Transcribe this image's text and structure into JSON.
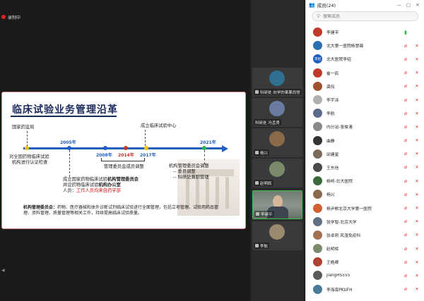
{
  "recording": {
    "label": "录制中"
  },
  "slide": {
    "title": "临床试验业务管理沿革",
    "years": [
      "2005年",
      "2008年",
      "2014年",
      "2017年",
      "2021年"
    ],
    "left_top": "国家药监局",
    "left_desc1": "对全国药物临床试验",
    "left_desc2": "机构进行认证检查",
    "center_top": "成立临床试验中心",
    "mid_label": "管理委员会成员调整",
    "est1": "成立国家药物临床试验",
    "est1_bold": "机构管理委员会",
    "est2": "并设药物临床试验",
    "est2_bold": "机构办公室",
    "est3_prefix": "人员：",
    "est3_red": "工作人员均来自药学部",
    "adj1": "机构管理委员会调整",
    "adj2": "-- 委员调整",
    "adj3": "-- 科研处兼职管理",
    "bottom_bold": "机构管理委员会：",
    "bottom_text": "药物、医疗器械和体外诊断试剂临床试验进行全面管理，包括立项管理、试验用药品管理、资料管理、质量管理等相关工作，持续提高临床试验质量。",
    "colors": {
      "timeline": "#1f5fbf",
      "title": "#1a2a5a",
      "highlight_red": "#d01010"
    }
  },
  "video_tiles": [
    {
      "name": "科研处 向学的果果尚常",
      "avatar_color": "#2f6f8f"
    },
    {
      "name": "科研处 冯孟贤",
      "avatar_color": "#6a7aa0"
    },
    {
      "name": "杨兴",
      "avatar_color": "#8a6a4a"
    },
    {
      "name": "赵明辉",
      "avatar_color": "#7a8a6a"
    },
    {
      "name": "李建平",
      "avatar_color": "#000000",
      "camera": true
    },
    {
      "name": "于 ",
      "avatar_color": "#9a8a70"
    },
    {
      "name": "李航",
      "avatar_color": "#5a6a8a"
    }
  ],
  "panel": {
    "title": "成员(24)",
    "search_placeholder": "搜索成员",
    "members": [
      {
        "name": "李建平",
        "avatar_color": "#c0392b",
        "mic_on": true,
        "cam_icon": ""
      },
      {
        "name": "北大第一医院杨慧薇",
        "avatar_color": "#2a6fb0",
        "mic_on": false,
        "cam_icon": "✕"
      },
      {
        "name": "北大医院李绍",
        "avatar_color": "#1f5fbf",
        "avatar_text": "李绍",
        "mic_on": false,
        "cam_icon": "✕"
      },
      {
        "name": "崔一民",
        "avatar_color": "#c0392b",
        "mic_on": false,
        "cam_icon": "✕"
      },
      {
        "name": "龚侃",
        "avatar_color": "#a0522d",
        "mic_on": false,
        "cam_icon": "✕"
      },
      {
        "name": "李宇泽",
        "avatar_color": "#b0b0b0",
        "mic_on": false,
        "cam_icon": "✕"
      },
      {
        "name": "李航",
        "avatar_color": "#5a6a8a",
        "mic_on": false,
        "cam_icon": "✕"
      },
      {
        "name": "内分泌-张俊清",
        "avatar_color": "#8a8a8a",
        "mic_on": false,
        "cam_icon": "✕"
      },
      {
        "name": "曲静",
        "avatar_color": "#333333",
        "mic_on": false,
        "cam_icon": "✕"
      },
      {
        "name": "邱建星",
        "avatar_color": "#7a6a5a",
        "mic_on": false,
        "cam_icon": "✕"
      },
      {
        "name": "王东信",
        "avatar_color": "#4a4a4a",
        "mic_on": false,
        "cam_icon": "✕"
      },
      {
        "name": "杨柯-北大医院",
        "avatar_color": "#3a6a3a",
        "mic_on": false,
        "cam_icon": "✕"
      },
      {
        "name": "杨兴",
        "avatar_color": "#8a6a4a",
        "mic_on": false,
        "cam_icon": "✕"
      },
      {
        "name": "杨尹默北京大学第一医院",
        "avatar_color": "#d06030",
        "mic_on": false,
        "cam_icon": "✕"
      },
      {
        "name": "张学智-北京大学",
        "avatar_color": "#607080",
        "mic_on": false,
        "cam_icon": "✕"
      },
      {
        "name": "张卓莉 风湿免疫科",
        "avatar_color": "#a07050",
        "mic_on": false,
        "cam_icon": "✕"
      },
      {
        "name": "赵明辉",
        "avatar_color": "#7a8a6a",
        "mic_on": false,
        "cam_icon": "✕"
      },
      {
        "name": "王皓卿",
        "avatar_color": "#b04030",
        "mic_on": false,
        "cam_icon": "✕"
      },
      {
        "name": "JiangHS555",
        "avatar_color": "#5a5a5a",
        "mic_on": false,
        "cam_icon": "✕"
      },
      {
        "name": "李海南PKUFH",
        "avatar_color": "#4a7a9a",
        "mic_on": false,
        "cam_icon": "✕"
      }
    ]
  }
}
